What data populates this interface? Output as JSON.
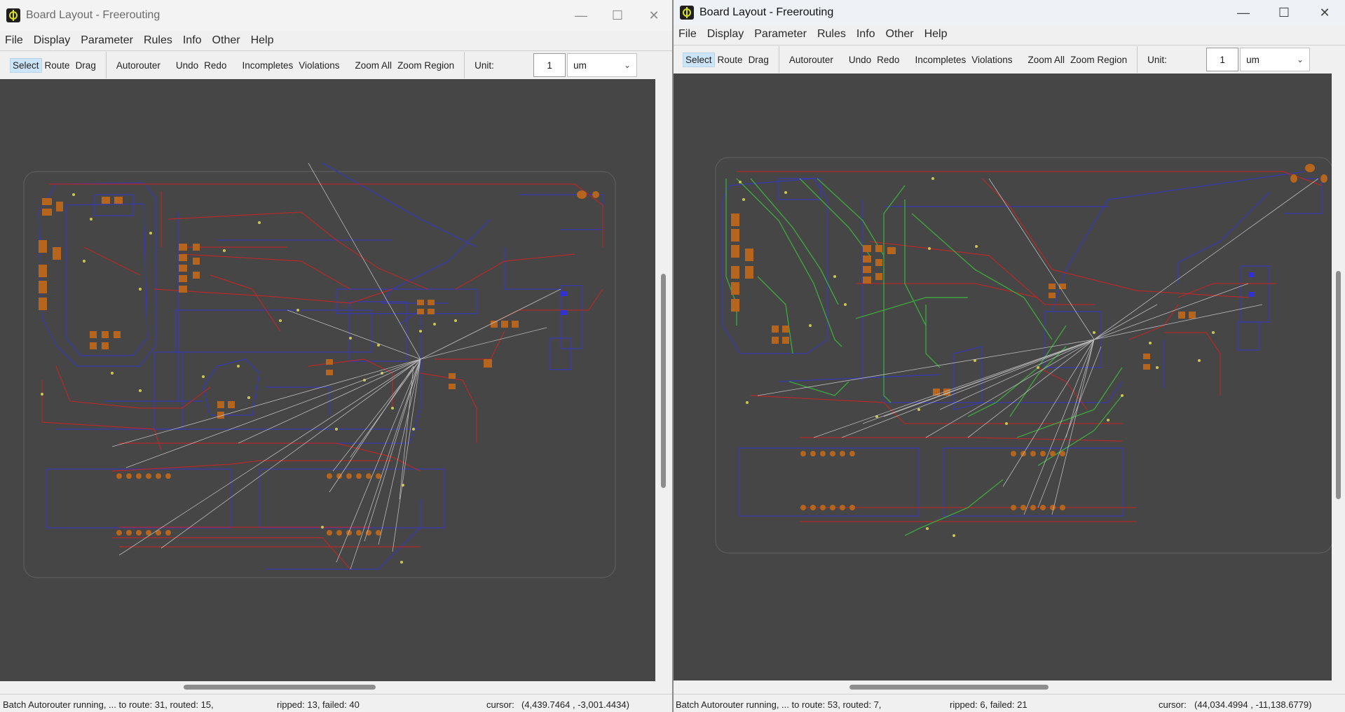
{
  "left_window": {
    "title": "Board Layout - Freerouting",
    "controls": {
      "minimize": "—",
      "maximize": "☐",
      "close": "✕"
    },
    "menu": [
      "File",
      "Display",
      "Parameter",
      "Rules",
      "Info",
      "Other",
      "Help"
    ],
    "toolbar": {
      "select": "Select",
      "route": "Route",
      "drag": "Drag",
      "autorouter": "Autorouter",
      "undo": "Undo",
      "redo": "Redo",
      "incompletes": "Incompletes",
      "violations": "Violations",
      "zoom_all": "Zoom All",
      "zoom_region": "Zoom Region",
      "unit_label": "Unit:",
      "unit_value": "1",
      "unit_select": "um"
    },
    "status": {
      "progress": "Batch Autorouter running, ... to route: 31, routed: 15,",
      "result": "ripped: 13, failed: 40",
      "cursor_label": "cursor:",
      "cursor_value": "(4,439.7464 , -3,001.4434)"
    }
  },
  "right_window": {
    "title": "Board Layout - Freerouting",
    "controls": {
      "minimize": "—",
      "maximize": "☐",
      "close": "✕"
    },
    "menu": [
      "File",
      "Display",
      "Parameter",
      "Rules",
      "Info",
      "Other",
      "Help"
    ],
    "toolbar": {
      "select": "Select",
      "route": "Route",
      "drag": "Drag",
      "autorouter": "Autorouter",
      "undo": "Undo",
      "redo": "Redo",
      "incompletes": "Incompletes",
      "violations": "Violations",
      "zoom_all": "Zoom All",
      "zoom_region": "Zoom Region",
      "unit_label": "Unit:",
      "unit_value": "1",
      "unit_select": "um"
    },
    "status": {
      "progress": "Batch Autorouter running, ... to route: 53, routed: 7,",
      "result": "ripped: 6, failed: 21",
      "cursor_label": "cursor:",
      "cursor_value": "(44,034.4994 , -11,138.6779)"
    }
  },
  "colors": {
    "canvas_bg": "#464646",
    "board_outline": "#5c5c5c",
    "top_layer_trace": "#b52a2a",
    "bottom_layer_trace": "#3a3ab0",
    "routed_trace": "#3fa33f",
    "pad": "#b5651d",
    "via": "#c8c850",
    "ratsnest": "#cfcfcf",
    "active_tool_bg": "#cce4f7"
  }
}
